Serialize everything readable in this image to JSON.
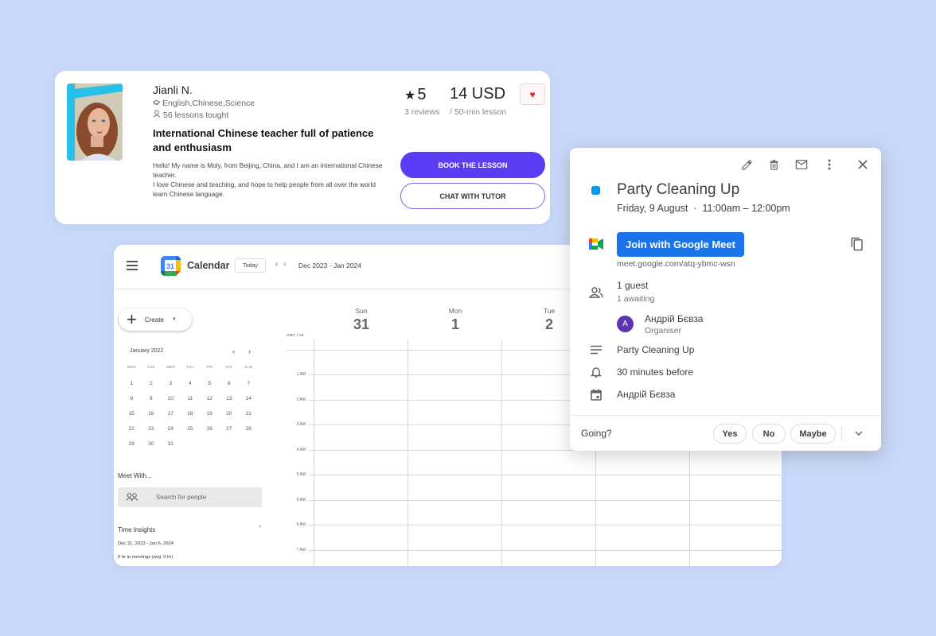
{
  "tutor": {
    "name": "Jianli N.",
    "subjects": "English,Chinese,Science",
    "lessons": "56 lessons tought",
    "headline": "International Chinese teacher full of patience and enthusiasm",
    "bio_line1": "Hello! My name is Moly, from Beijing, China, and I am an international Chinese teacher.",
    "bio_line2": "I love Chinese and teaching, and hope to help people from all over the world learn Chinese language.",
    "rating": "5",
    "star_glyph": "★",
    "reviews": "3 reviews",
    "price": "14 USD",
    "per_lesson": "/ 50-min lesson",
    "favorite_icon": "heart-icon",
    "favorite_glyph": "♥",
    "book_label": "BOOK THE LESSON",
    "chat_label": "CHAT WITH TUTOR",
    "colors": {
      "primary": "#5b3df5",
      "heart": "#e0262f"
    }
  },
  "calendar": {
    "app_title": "Calendar",
    "logo_day": "31",
    "today_label": "Today",
    "prev_glyph": "‹",
    "next_glyph": "›",
    "date_range": "Dec 2023 - Jan 2024",
    "create_label": "Create",
    "create_plus": "+",
    "create_caret": "▼",
    "mini": {
      "month": "January 2022",
      "prev": "‹",
      "next": "›",
      "weekdays": [
        "MON",
        "TUE",
        "WED",
        "THU",
        "FRI",
        "SAT",
        "SUN"
      ],
      "days": [
        "1",
        "2",
        "3",
        "4",
        "5",
        "6",
        "7",
        "8",
        "9",
        "10",
        "11",
        "12",
        "13",
        "14",
        "15",
        "16",
        "17",
        "18",
        "19",
        "20",
        "21",
        "22",
        "23",
        "24",
        "25",
        "26",
        "27",
        "28",
        "29",
        "30",
        "31"
      ]
    },
    "meet_with_label": "Meet With...",
    "people_search_placeholder": "Search for people",
    "insights": {
      "title": "Time Insights",
      "toggle": "^",
      "range": "Dec 31, 2023 - Jan 6, 2024",
      "meetings": "0 hr in meetings (avg: 0 hr)"
    },
    "timezone": "GMT + 06",
    "days": [
      {
        "dow": "Sun",
        "num": "31"
      },
      {
        "dow": "Mon",
        "num": "1"
      },
      {
        "dow": "Tue",
        "num": "2"
      }
    ],
    "time_labels": [
      "1 AM",
      "2 AM",
      "3 AM",
      "4 AM",
      "5 AM",
      "6 AM",
      "6 AM",
      "7 AM"
    ]
  },
  "event": {
    "color": "#039be5",
    "title": "Party Cleaning Up",
    "when": "Friday, 9 August  ·  11:00am – 12:00pm",
    "meet_button": "Join with Google Meet",
    "meet_link": "meet.google.com/atq-ybmc-wsn",
    "guests": "1 guest",
    "awaiting": "1 awaiting",
    "guest_initial": "A",
    "guest_name": "Андрій Бєвза",
    "guest_role": "Organiser",
    "description": "Party Cleaning Up",
    "reminder": "30 minutes before",
    "calendar_owner": "Андрій Бєвза",
    "going_label": "Going?",
    "rsvp": {
      "yes": "Yes",
      "no": "No",
      "maybe": "Maybe"
    },
    "accent": "#1a73e8"
  }
}
